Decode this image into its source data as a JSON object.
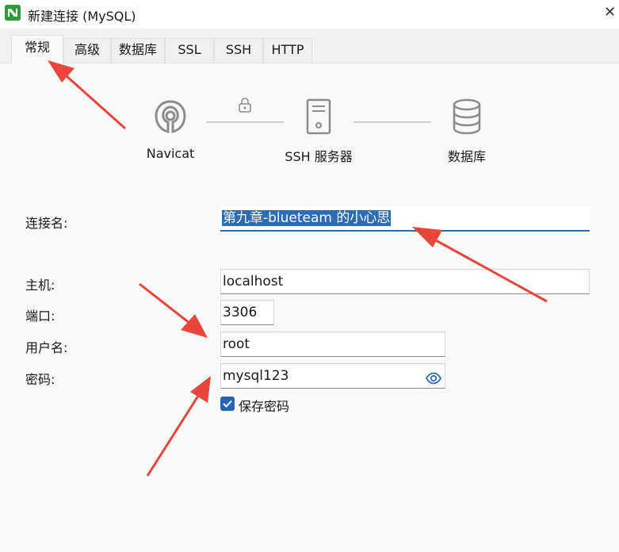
{
  "window": {
    "title": "新建连接 (MySQL)",
    "close_glyph": "✕"
  },
  "tabs": [
    {
      "label": "常规",
      "active": true
    },
    {
      "label": "高级",
      "active": false
    },
    {
      "label": "数据库",
      "active": false
    },
    {
      "label": "SSL",
      "active": false
    },
    {
      "label": "SSH",
      "active": false
    },
    {
      "label": "HTTP",
      "active": false
    }
  ],
  "diagram": {
    "steps": [
      {
        "label": "Navicat",
        "icon": "navicat-logo-icon"
      },
      {
        "label": "SSH 服务器",
        "icon": "server-icon"
      },
      {
        "label": "数据库",
        "icon": "database-icon"
      }
    ],
    "connector_icon": "lock-icon"
  },
  "form": {
    "connection_name": {
      "label": "连接名:",
      "value": "第九章-blueteam 的小心思"
    },
    "host": {
      "label": "主机:",
      "value": "localhost"
    },
    "port": {
      "label": "端口:",
      "value": "3306"
    },
    "username": {
      "label": "用户名:",
      "value": "root"
    },
    "password": {
      "label": "密码:",
      "value": "mysql123",
      "icon": "eye-icon"
    },
    "save_password": {
      "label": "保存密码",
      "checked": true
    }
  },
  "colors": {
    "accent": "#2b6cb5",
    "annotation_arrow": "#e8453c"
  }
}
